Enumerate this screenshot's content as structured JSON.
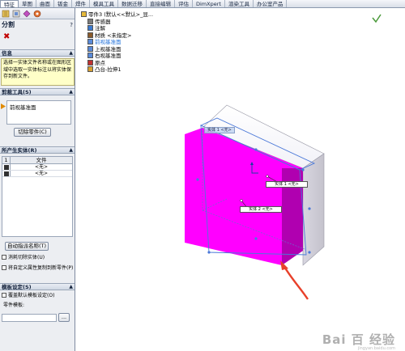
{
  "tabs": [
    "特征",
    "草图",
    "曲面",
    "钣金",
    "焊件",
    "模具工具",
    "数据迁移",
    "直接编辑",
    "评估",
    "DimXpert",
    "渲染工具",
    "办公室产品"
  ],
  "panel": {
    "title": "分割",
    "help": "?",
    "message_section": "信息",
    "message_lines": [
      "选择一实体文件名称或在图形区",
      "域中选取一实体标注以将实体保",
      "存到新文件。"
    ],
    "trim_section": "剪裁工具(S)",
    "trim_list_item": "前视基准面",
    "cut_button": "切除零件(C)",
    "bodies_section": "所产生实体(R)",
    "table_header_num": "1",
    "table_header_file": "文件",
    "table_rows": [
      "<无>",
      "<无>"
    ],
    "auto_name_button": "自动指派名称(T)",
    "consume_option": "消耗切除实体(U)",
    "propagate_option": "将自定义属性复制到新零件(P)",
    "template_section": "模板设定(S)",
    "override_option": "覆盖默认模板设定(O)",
    "template_label": "零件模板:",
    "browse_button": "..."
  },
  "tree": {
    "items": [
      {
        "label": "零件3 (默认<<默认>_显...",
        "icon": "part-icon"
      },
      {
        "label": "传感器",
        "icon": "sensor-icon"
      },
      {
        "label": "注解",
        "icon": "annotation-icon"
      },
      {
        "label": "材质 <未指定>",
        "icon": "material-icon"
      },
      {
        "label": "前视基准面",
        "icon": "plane-icon",
        "selected": true
      },
      {
        "label": "上视基准面",
        "icon": "plane-icon"
      },
      {
        "label": "右视基准面",
        "icon": "plane-icon"
      },
      {
        "label": "原点",
        "icon": "origin-icon"
      },
      {
        "label": "凸台-拉伸1",
        "icon": "extrude-icon"
      }
    ]
  },
  "viewport": {
    "label1": "实体 1 <无>",
    "label2": "实体 2 <无>",
    "label3": "实体 1 <无>",
    "watermark": "Bai 百 经验",
    "watermark_url": "jingyan.baidu.com"
  },
  "colors": {
    "magenta": "#ff00ff",
    "arrow": "#e8402a"
  }
}
